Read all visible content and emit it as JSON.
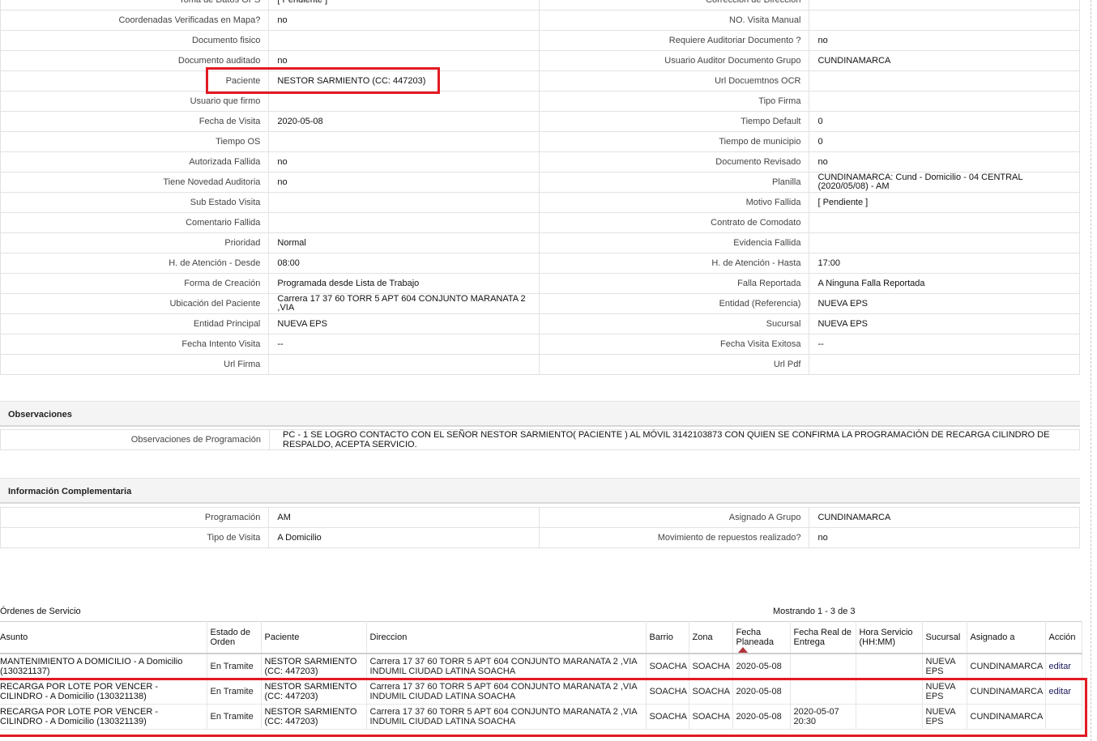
{
  "detail_rows": [
    {
      "l1": "Toma de Datos GPS",
      "v1": "[ Pendiente ]",
      "l2": "Corrección de Dirección",
      "v2": ""
    },
    {
      "l1": "Coordenadas Verificadas en Mapa?",
      "v1": "no",
      "l2": "NO. Visita Manual",
      "v2": ""
    },
    {
      "l1": "Documento fisico",
      "v1": "",
      "l2": "Requiere Auditoriar Documento ?",
      "v2": "no"
    },
    {
      "l1": "Documento auditado",
      "v1": "no",
      "l2": "Usuario Auditor Documento Grupo",
      "v2": "CUNDINAMARCA"
    },
    {
      "l1": "Paciente",
      "v1": "NESTOR SARMIENTO (CC: 447203)",
      "l2": "Url Docuemtnos OCR",
      "v2": ""
    },
    {
      "l1": "Usuario que firmo",
      "v1": "",
      "l2": "Tipo Firma",
      "v2": ""
    },
    {
      "l1": "Fecha de Visita",
      "v1": "2020-05-08",
      "l2": "Tiempo Default",
      "v2": "0"
    },
    {
      "l1": "Tiempo OS",
      "v1": "",
      "l2": "Tiempo de municipio",
      "v2": "0"
    },
    {
      "l1": "Autorizada Fallida",
      "v1": "no",
      "l2": "Documento Revisado",
      "v2": "no"
    },
    {
      "l1": "Tiene Novedad Auditoria",
      "v1": "no",
      "l2": "Planilla",
      "v2": "CUNDINAMARCA: Cund - Domicilio - 04 CENTRAL (2020/05/08) - AM"
    },
    {
      "l1": "Sub Estado Visita",
      "v1": "",
      "l2": "Motivo Fallida",
      "v2": "[ Pendiente ]"
    },
    {
      "l1": "Comentario Fallida",
      "v1": "",
      "l2": "Contrato de Comodato",
      "v2": ""
    },
    {
      "l1": "Prioridad",
      "v1": "Normal",
      "l2": "Evidencia Fallida",
      "v2": ""
    },
    {
      "l1": "H. de Atención - Desde",
      "v1": "08:00",
      "l2": "H. de Atención - Hasta",
      "v2": "17:00"
    },
    {
      "l1": "Forma de Creación",
      "v1": "Programada desde Lista de Trabajo",
      "l2": "Falla Reportada",
      "v2": "A Ninguna Falla Reportada"
    },
    {
      "l1": "Ubicación del Paciente",
      "v1": "Carrera 17 37 60 TORR 5 APT 604 CONJUNTO MARANATA 2 ,VIA",
      "l2": "Entidad (Referencia)",
      "v2": "NUEVA EPS"
    },
    {
      "l1": "Entidad Principal",
      "v1": "NUEVA EPS",
      "l2": "Sucursal",
      "v2": "NUEVA EPS"
    },
    {
      "l1": "Fecha Intento Visita",
      "v1": "--",
      "l2": "Fecha Visita Exitosa",
      "v2": "--"
    },
    {
      "l1": "Url Firma",
      "v1": "",
      "l2": "Url Pdf",
      "v2": ""
    }
  ],
  "observaciones": {
    "title": "Observaciones",
    "label": "Observaciones de Programación",
    "value": "PC - 1 SE LOGRO CONTACTO CON EL SEÑOR NESTOR SARMIENTO( PACIENTE ) AL MÓVIL 3142103873 CON QUIEN SE CONFIRMA LA PROGRAMACIÓN DE RECARGA CILINDRO DE RESPALDO, ACEPTA SERVICIO."
  },
  "complementaria": {
    "title": "Información Complementaria",
    "rows": [
      {
        "l1": "Programación",
        "v1": "AM",
        "l2": "Asignado A Grupo",
        "v2": "CUNDINAMARCA"
      },
      {
        "l1": "Tipo de Visita",
        "v1": "A Domicilio",
        "l2": "Movimiento de repuestos realizado?",
        "v2": "no"
      }
    ]
  },
  "ordenes": {
    "title": "Órdenes de Servicio",
    "count": "Mostrando 1 - 3 de 3",
    "headers": [
      "Asunto",
      "Estado de Orden",
      "Paciente",
      "Direccion",
      "Barrio",
      "Zona",
      "Fecha Planeada",
      "Fecha Real de Entrega",
      "Hora Servicio (HH:MM)",
      "Sucursal",
      "Asignado a",
      "Acción"
    ],
    "rows": [
      {
        "asunto": "MANTENIMIENTO A DOMICILIO - A Domicilio (130321137)",
        "estado": "En Tramite",
        "paciente": "NESTOR SARMIENTO (CC: 447203)",
        "direccion": "Carrera 17 37 60 TORR 5 APT 604 CONJUNTO MARANATA 2 ,VIA INDUMIL CIUDAD LATINA SOACHA",
        "barrio": "SOACHA",
        "zona": "SOACHA",
        "fecha_planeada": "2020-05-08",
        "fecha_real": "",
        "hora": "",
        "sucursal": "NUEVA EPS",
        "asignado": "CUNDINAMARCA",
        "accion": "editar"
      },
      {
        "asunto": "RECARGA POR LOTE POR VENCER - CILINDRO - A Domicilio (130321138)",
        "estado": "En Tramite",
        "paciente": "NESTOR SARMIENTO (CC: 447203)",
        "direccion": "Carrera 17 37 60 TORR 5 APT 604 CONJUNTO MARANATA 2 ,VIA INDUMIL CIUDAD LATINA SOACHA",
        "barrio": "SOACHA",
        "zona": "SOACHA",
        "fecha_planeada": "2020-05-08",
        "fecha_real": "",
        "hora": "",
        "sucursal": "NUEVA EPS",
        "asignado": "CUNDINAMARCA",
        "accion": "editar"
      },
      {
        "asunto": "RECARGA POR LOTE POR VENCER - CILINDRO - A Domicilio (130321139)",
        "estado": "En Tramite",
        "paciente": "NESTOR SARMIENTO (CC: 447203)",
        "direccion": "Carrera 17 37 60 TORR 5 APT 604 CONJUNTO MARANATA 2 ,VIA INDUMIL CIUDAD LATINA SOACHA",
        "barrio": "SOACHA",
        "zona": "SOACHA",
        "fecha_planeada": "2020-05-08",
        "fecha_real": "2020-05-07 20:30",
        "hora": "",
        "sucursal": "NUEVA EPS",
        "asignado": "CUNDINAMARCA",
        "accion": ""
      }
    ]
  },
  "colors": {
    "highlight": "#e21a22",
    "sort_arrow": "#b0343a",
    "section_bg": "#f4f4f4"
  }
}
